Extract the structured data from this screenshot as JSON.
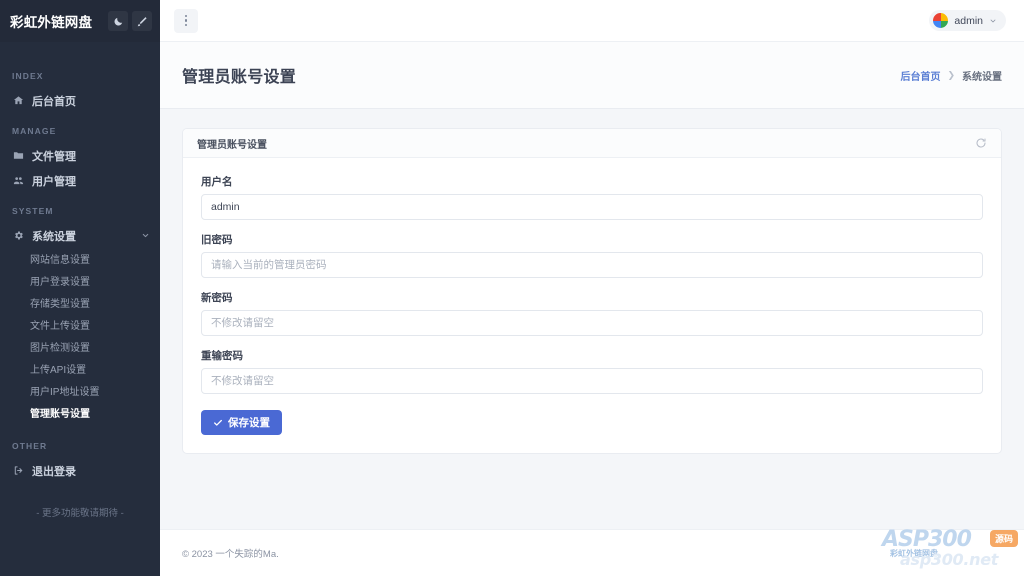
{
  "sidebar": {
    "brand": {
      "title": "彩虹外链网盘",
      "dark_mode_icon": "moon-icon",
      "theme_icon": "brush-icon"
    },
    "sections": [
      {
        "label": "INDEX",
        "items": [
          {
            "label": "后台首页",
            "icon": "home-icon"
          }
        ]
      },
      {
        "label": "MANAGE",
        "items": [
          {
            "label": "文件管理",
            "icon": "folder-icon"
          },
          {
            "label": "用户管理",
            "icon": "users-icon"
          }
        ]
      },
      {
        "label": "SYSTEM",
        "items": [
          {
            "label": "系统设置",
            "icon": "gear-icon",
            "expanded": true
          }
        ],
        "subitems": [
          {
            "label": "网站信息设置",
            "active": false
          },
          {
            "label": "用户登录设置",
            "active": false
          },
          {
            "label": "存储类型设置",
            "active": false
          },
          {
            "label": "文件上传设置",
            "active": false
          },
          {
            "label": "图片检测设置",
            "active": false
          },
          {
            "label": "上传API设置",
            "active": false
          },
          {
            "label": "用户IP地址设置",
            "active": false
          },
          {
            "label": "管理账号设置",
            "active": true
          }
        ]
      },
      {
        "label": "OTHER",
        "items": [
          {
            "label": "退出登录",
            "icon": "logout-icon"
          }
        ]
      }
    ],
    "footer_note": "- 更多功能敬请期待 -"
  },
  "topbar": {
    "menu_icon": "vertical-dots-icon",
    "user": {
      "name": "admin",
      "avatar_icon": "color-wheel-avatar",
      "chevron_icon": "chevron-down-icon"
    }
  },
  "page": {
    "title": "管理员账号设置",
    "breadcrumb": {
      "home": "后台首页",
      "separator": "❯",
      "current": "系统设置"
    }
  },
  "card": {
    "title": "管理员账号设置",
    "refresh_icon": "refresh-icon",
    "fields": [
      {
        "label": "用户名",
        "name": "username",
        "value": "admin",
        "placeholder": ""
      },
      {
        "label": "旧密码",
        "name": "old-password",
        "value": "",
        "placeholder": "请输入当前的管理员密码"
      },
      {
        "label": "新密码",
        "name": "new-password",
        "value": "",
        "placeholder": "不修改请留空"
      },
      {
        "label": "重输密码",
        "name": "confirm-password",
        "value": "",
        "placeholder": "不修改请留空"
      }
    ],
    "save_button": {
      "label": "保存设置",
      "icon": "check-icon"
    }
  },
  "footer": {
    "copyright": "© 2023 一个失踪的Ma."
  },
  "watermark": {
    "brand": "ASP300",
    "badge": "源码",
    "domain": "asp300.net",
    "subtitle": "彩虹外链网盘"
  },
  "colors": {
    "sidebar_bg": "#252d3d",
    "accent": "#4a69d4",
    "breadcrumb_link": "#5b7fd4",
    "page_bg": "#f4f6f9"
  }
}
